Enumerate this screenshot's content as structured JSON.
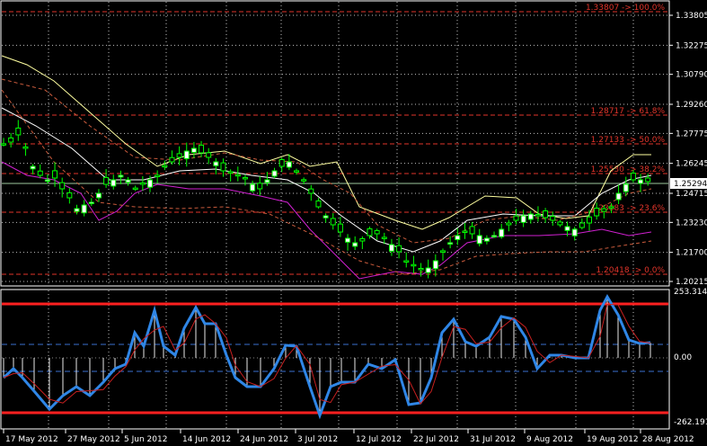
{
  "chart": {
    "price_axis": [
      "1.33805",
      "1.32275",
      "1.30790",
      "1.29260",
      "1.27775",
      "1.26245",
      "1.24715",
      "1.23230",
      "1.21700",
      "1.20215"
    ],
    "current_price": "1.25294",
    "fib_levels": [
      {
        "label": "1.33807 -> 100.0%"
      },
      {
        "label": "1.28717 -> 61.8%"
      },
      {
        "label": "1.27133 -> 50.0%"
      },
      {
        "label": "1.25530 -> 38.2%"
      },
      {
        "label": "1.23883 -> 23.6%"
      },
      {
        "label": "1.20418 -> 0.0%"
      }
    ],
    "osc_axis": {
      "top": "253.3145",
      "zero": "0.00",
      "bottom": "-262.191"
    },
    "date_labels": [
      "17 May 2012",
      "27 May 2012",
      "5 Jun 2012",
      "14 Jun 2012",
      "24 Jun 2012",
      "3 Jul 2012",
      "12 Jul 2012",
      "22 Jul 2012",
      "31 Jul 2012",
      "9 Aug 2012",
      "19 Aug 2012",
      "28 Aug 2012"
    ],
    "colors": {
      "bull": "#ffffff",
      "bear": "#00ff00",
      "wick": "#00ff00",
      "fib": "#e0342a",
      "ma_upper": "#ffffa0",
      "ma_lower": "#d020d0",
      "osc_main": "#2f86e6",
      "osc_signal": "#c82020",
      "osc_level": "#ff2020"
    }
  }
}
